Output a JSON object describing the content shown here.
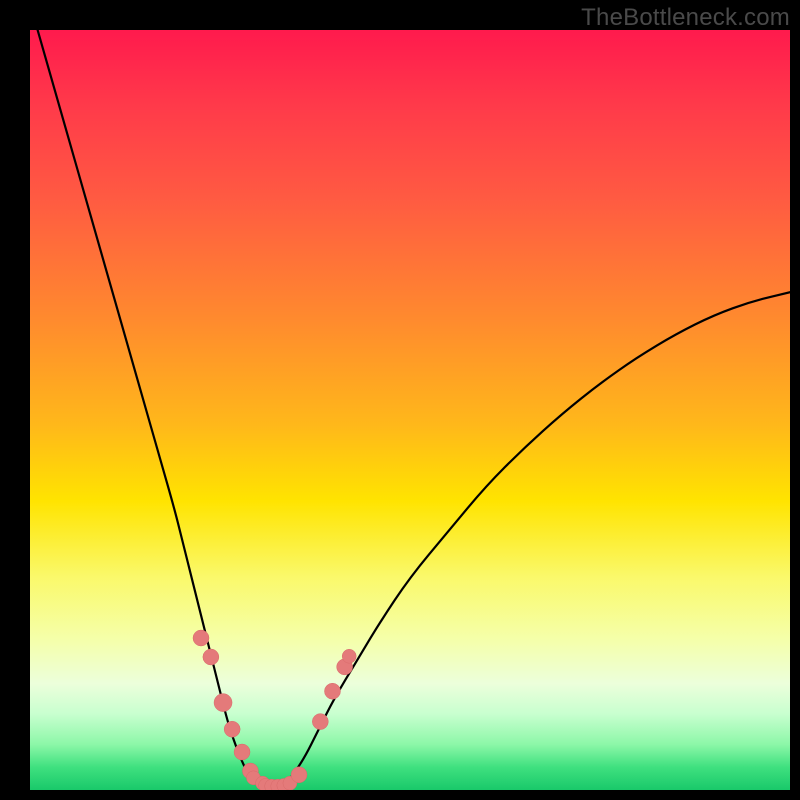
{
  "watermark": {
    "text": "TheBottleneck.com"
  },
  "chart_data": {
    "type": "line",
    "title": "",
    "xlabel": "",
    "ylabel": "",
    "xlim": [
      0,
      100
    ],
    "ylim": [
      0,
      100
    ],
    "grid": false,
    "series": [
      {
        "name": "left-branch",
        "x": [
          1,
          3,
          5,
          7,
          9,
          11,
          13,
          15,
          17,
          19,
          20,
          21,
          22,
          23,
          24,
          25,
          26,
          27,
          28,
          29,
          30
        ],
        "y": [
          100,
          93,
          86,
          79,
          72,
          65,
          58,
          51,
          44,
          37,
          33,
          29,
          25,
          21,
          17,
          13,
          9,
          6,
          3.5,
          1.5,
          0.8
        ]
      },
      {
        "name": "valley-floor",
        "x": [
          30,
          31,
          32,
          33,
          34
        ],
        "y": [
          0.8,
          0.5,
          0.5,
          0.7,
          1.2
        ]
      },
      {
        "name": "right-branch",
        "x": [
          34,
          36,
          38,
          40,
          43,
          46,
          50,
          55,
          60,
          65,
          70,
          75,
          80,
          85,
          90,
          95,
          100
        ],
        "y": [
          1.2,
          4,
          8,
          12,
          17,
          22,
          28,
          34,
          40,
          45,
          49.5,
          53.5,
          57,
          60,
          62.5,
          64.3,
          65.5
        ]
      }
    ],
    "scatter": {
      "name": "highlight-dots",
      "color": "#e47a7a",
      "x": [
        22.5,
        23.8,
        25.4,
        26.6,
        27.9,
        29.0,
        29.4,
        30.6,
        31.0,
        31.8,
        32.6,
        33.4,
        34.2,
        35.4,
        38.2,
        39.8,
        41.4,
        42.0
      ],
      "y": [
        20.0,
        17.5,
        11.5,
        8.0,
        5.0,
        2.5,
        1.6,
        0.9,
        0.6,
        0.5,
        0.5,
        0.6,
        0.9,
        2.0,
        9.0,
        13.0,
        16.2,
        17.6
      ],
      "r": [
        8,
        8,
        9,
        8,
        8,
        8,
        7,
        7,
        7,
        7,
        7,
        7,
        7,
        8,
        8,
        8,
        8,
        7
      ]
    }
  }
}
